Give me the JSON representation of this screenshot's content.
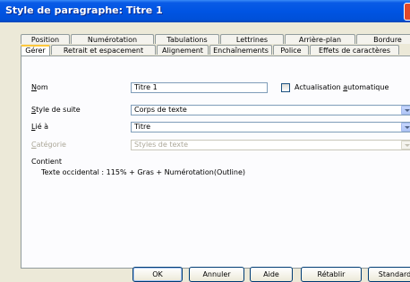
{
  "window": {
    "title": "Style de paragraphe: Titre 1"
  },
  "tabs_row1": [
    "Position",
    "Numérotation",
    "Tabulations",
    "Lettrines",
    "Arrière-plan",
    "Bordure"
  ],
  "tabs_row2": [
    "Gérer",
    "Retrait et espacement",
    "Alignement",
    "Enchaînements",
    "Police",
    "Effets de caractères"
  ],
  "active_tab": "Gérer",
  "form": {
    "name": {
      "label_u": "N",
      "label_rest": "om",
      "value": "Titre 1"
    },
    "auto_update": {
      "label_pre": "Actualisation ",
      "label_u": "a",
      "label_rest": "utomatique",
      "checked": false
    },
    "next_style": {
      "label_u": "S",
      "label_rest": "tyle de suite",
      "value": "Corps de texte"
    },
    "linked_to": {
      "label_u": "L",
      "label_rest": "ié à",
      "value": "Titre"
    },
    "category": {
      "label_u": "C",
      "label_rest": "atégorie",
      "value": "Styles de texte",
      "disabled": true
    }
  },
  "contains": {
    "heading": "Contient",
    "text": "Texte occidental : 115% + Gras + Numérotation(Outline)"
  },
  "buttons": {
    "ok": "OK",
    "cancel": "Annuler",
    "help": "Aide",
    "reset": "Rétablir",
    "standard": "Standard"
  }
}
